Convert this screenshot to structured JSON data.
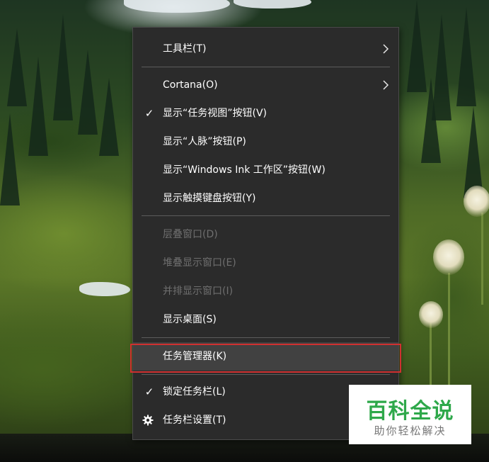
{
  "menu": {
    "items": [
      {
        "label": "工具栏(T)",
        "submenu": true,
        "checked": false,
        "disabled": false
      },
      {
        "label": "Cortana(O)",
        "submenu": true,
        "checked": false,
        "disabled": false
      },
      {
        "label": "显示“任务视图”按钮(V)",
        "submenu": false,
        "checked": true,
        "disabled": false
      },
      {
        "label": "显示“人脉”按钮(P)",
        "submenu": false,
        "checked": false,
        "disabled": false
      },
      {
        "label": "显示“Windows Ink 工作区”按钮(W)",
        "submenu": false,
        "checked": false,
        "disabled": false
      },
      {
        "label": "显示触摸键盘按钮(Y)",
        "submenu": false,
        "checked": false,
        "disabled": false
      },
      {
        "label": "层叠窗口(D)",
        "submenu": false,
        "checked": false,
        "disabled": true
      },
      {
        "label": "堆叠显示窗口(E)",
        "submenu": false,
        "checked": false,
        "disabled": true
      },
      {
        "label": "并排显示窗口(I)",
        "submenu": false,
        "checked": false,
        "disabled": true
      },
      {
        "label": "显示桌面(S)",
        "submenu": false,
        "checked": false,
        "disabled": false
      },
      {
        "label": "任务管理器(K)",
        "submenu": false,
        "checked": false,
        "disabled": false,
        "highlighted": true
      },
      {
        "label": "锁定任务栏(L)",
        "submenu": false,
        "checked": true,
        "disabled": false
      },
      {
        "label": "任务栏设置(T)",
        "submenu": false,
        "checked": false,
        "disabled": false,
        "icon": "gear-icon"
      }
    ],
    "check_glyph": "✓"
  },
  "watermark": {
    "title": "百科全说",
    "subtitle": "助你轻松解决"
  },
  "colors": {
    "menu_bg": "#2b2b2b",
    "menu_text": "#ffffff",
    "menu_disabled_text": "#6f6f6f",
    "highlight_bg": "#414141",
    "annotation_border": "#d03030",
    "watermark_green": "#2ea84a"
  }
}
